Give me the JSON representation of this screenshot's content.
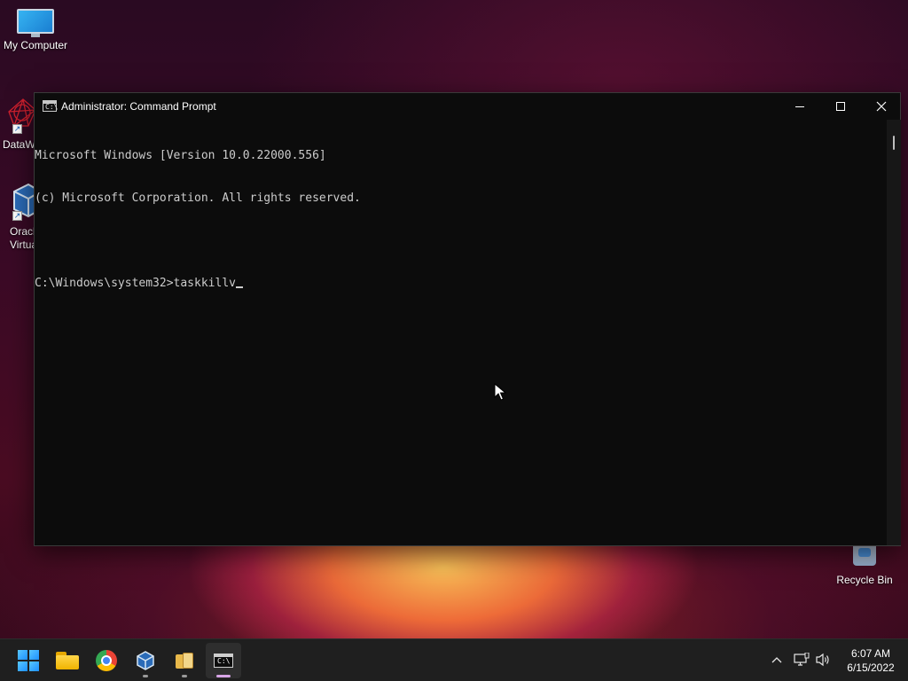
{
  "desktop": {
    "icons": [
      {
        "label": "My Computer",
        "icon": "monitor-icon"
      },
      {
        "label": "DataW",
        "icon": "datawrapper-icon"
      },
      {
        "label": "Oracl\nVirtua",
        "icon": "virtualbox-icon"
      },
      {
        "label": "Recycle Bin",
        "icon": "recycle-bin-icon"
      }
    ]
  },
  "window": {
    "title": "Administrator: Command Prompt",
    "app_icon_text": "C:\\",
    "controls": {
      "minimize": "minimize-icon",
      "maximize": "maximize-icon",
      "close": "close-icon"
    }
  },
  "console": {
    "lines": [
      "Microsoft Windows [Version 10.0.22000.556]",
      "(c) Microsoft Corporation. All rights reserved.",
      "",
      "C:\\Windows\\system32>taskkillv"
    ]
  },
  "taskbar": {
    "apps": [
      {
        "name": "start",
        "icon": "windows-logo-icon"
      },
      {
        "name": "file-explorer",
        "icon": "folder-icon"
      },
      {
        "name": "chrome",
        "icon": "chrome-icon"
      },
      {
        "name": "virtualbox",
        "icon": "virtualbox-icon"
      },
      {
        "name": "archive-manager",
        "icon": "package-icon"
      },
      {
        "name": "command-prompt",
        "icon": "cmd-icon",
        "active": true
      }
    ],
    "tray": {
      "chevron": "^",
      "network": "network-icon",
      "volume": "volume-icon"
    },
    "clock": {
      "time": "6:07 AM",
      "date": "6/15/2022"
    }
  }
}
